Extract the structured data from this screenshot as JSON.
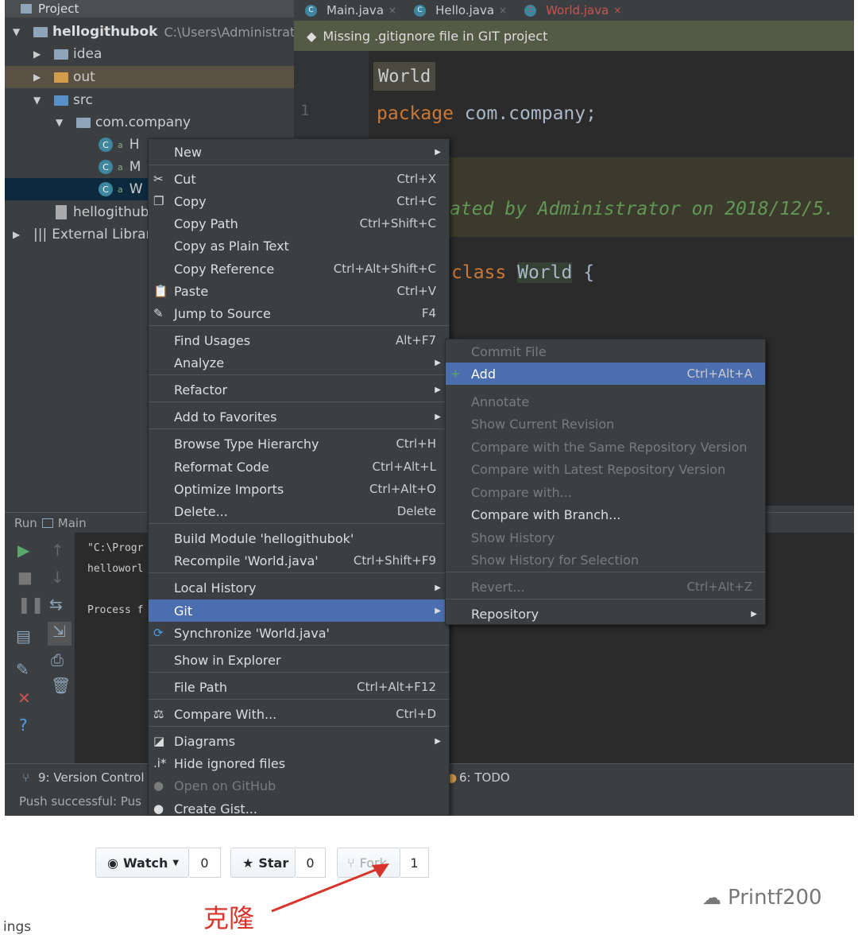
{
  "project": {
    "header": "Project",
    "root_name": "hellogithubok",
    "root_path": "C:\\Users\\Administrato",
    "items": [
      "idea",
      "out",
      "src",
      "com.company",
      "H",
      "M",
      "W",
      "hellogithub",
      "External Librari"
    ]
  },
  "tabs": [
    "Main.java",
    "Hello.java",
    "World.java"
  ],
  "banner": "Missing .gitignore file in GIT project",
  "editor": {
    "breadcrumb": "World",
    "line_number": "1",
    "package_kw": "package",
    "package_name": "com.company;",
    "comment": "ated by Administrator on 2018/12/5.",
    "class_kw": "class",
    "class_name": "World",
    "brace": "{"
  },
  "run": {
    "label": "Run",
    "config": "Main",
    "console": [
      "\"C:\\Progr",
      "helloworl",
      "Process f"
    ]
  },
  "statusbar": {
    "version_control": "9: Version Control",
    "todo": "6: TODO",
    "push": "Push successful: Pus"
  },
  "context_menu": [
    {
      "label": "New",
      "shortcut": "",
      "submenu": true,
      "icon": ""
    },
    {
      "label": "Cut",
      "shortcut": "Ctrl+X",
      "icon": "scissors-icon"
    },
    {
      "label": "Copy",
      "shortcut": "Ctrl+C",
      "icon": "copy-icon"
    },
    {
      "label": "Copy Path",
      "shortcut": "Ctrl+Shift+C"
    },
    {
      "label": "Copy as Plain Text",
      "shortcut": ""
    },
    {
      "label": "Copy Reference",
      "shortcut": "Ctrl+Alt+Shift+C"
    },
    {
      "label": "Paste",
      "shortcut": "Ctrl+V",
      "icon": "paste-icon"
    },
    {
      "label": "Jump to Source",
      "shortcut": "F4",
      "icon": "edit-icon"
    },
    {
      "label": "Find Usages",
      "shortcut": "Alt+F7"
    },
    {
      "label": "Analyze",
      "shortcut": "",
      "submenu": true
    },
    {
      "label": "Refactor",
      "shortcut": "",
      "submenu": true
    },
    {
      "label": "Add to Favorites",
      "shortcut": "",
      "submenu": true
    },
    {
      "label": "Browse Type Hierarchy",
      "shortcut": "Ctrl+H"
    },
    {
      "label": "Reformat Code",
      "shortcut": "Ctrl+Alt+L"
    },
    {
      "label": "Optimize Imports",
      "shortcut": "Ctrl+Alt+O"
    },
    {
      "label": "Delete...",
      "shortcut": "Delete"
    },
    {
      "label": "Build Module 'hellogithubok'",
      "shortcut": ""
    },
    {
      "label": "Recompile 'World.java'",
      "shortcut": "Ctrl+Shift+F9"
    },
    {
      "label": "Local History",
      "shortcut": "",
      "submenu": true
    },
    {
      "label": "Git",
      "shortcut": "",
      "submenu": true,
      "highlighted": true
    },
    {
      "label": "Synchronize 'World.java'",
      "shortcut": "",
      "icon": "sync-icon"
    },
    {
      "label": "Show in Explorer",
      "shortcut": ""
    },
    {
      "label": "File Path",
      "shortcut": "Ctrl+Alt+F12"
    },
    {
      "label": "Compare With...",
      "shortcut": "Ctrl+D",
      "icon": "compare-icon"
    },
    {
      "label": "Diagrams",
      "shortcut": "",
      "submenu": true,
      "icon": "diagram-icon"
    },
    {
      "label": "Hide ignored files",
      "shortcut": "",
      "icon": "hide-icon"
    },
    {
      "label": "Open on GitHub",
      "shortcut": "",
      "disabled": true,
      "icon": "github-icon"
    },
    {
      "label": "Create Gist...",
      "shortcut": "",
      "icon": "github-icon"
    }
  ],
  "git_menu": [
    {
      "label": "Commit File",
      "shortcut": "",
      "disabled": true
    },
    {
      "label": "Add",
      "shortcut": "Ctrl+Alt+A",
      "highlighted": true,
      "icon": "plus-icon"
    },
    {
      "label": "Annotate",
      "shortcut": "",
      "disabled": true
    },
    {
      "label": "Show Current Revision",
      "shortcut": "",
      "disabled": true
    },
    {
      "label": "Compare with the Same Repository Version",
      "shortcut": "",
      "disabled": true
    },
    {
      "label": "Compare with Latest Repository Version",
      "shortcut": "",
      "disabled": true
    },
    {
      "label": "Compare with...",
      "shortcut": "",
      "disabled": true
    },
    {
      "label": "Compare with Branch...",
      "shortcut": ""
    },
    {
      "label": "Show History",
      "shortcut": "",
      "disabled": true
    },
    {
      "label": "Show History for Selection",
      "shortcut": "",
      "disabled": true
    },
    {
      "label": "Revert...",
      "shortcut": "Ctrl+Alt+Z",
      "disabled": true
    },
    {
      "label": "Repository",
      "shortcut": "",
      "submenu": true
    }
  ],
  "github": {
    "watch_label": "Watch",
    "watch_count": "0",
    "star_label": "Star",
    "star_count": "0",
    "fork_label": "Fork",
    "fork_count": "1",
    "annotation": "克隆",
    "corner_text": "ings",
    "watermark": "Printf200"
  },
  "colors": {
    "menu_highlight": "#4b6eaf",
    "annotation_red": "#d9342b"
  }
}
